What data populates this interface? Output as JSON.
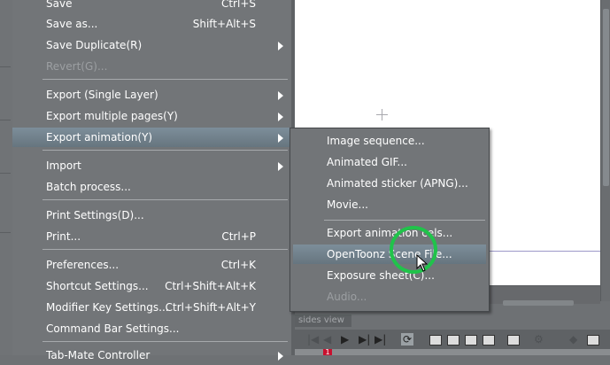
{
  "main_menu": {
    "items": [
      {
        "label": "Save",
        "shortcut": "Ctrl+S"
      },
      {
        "label": "Save as...",
        "shortcut": "Shift+Alt+S"
      },
      {
        "label": "Save Duplicate(R)"
      },
      {
        "label": "Revert(G)..."
      },
      {
        "label": "Export (Single Layer)"
      },
      {
        "label": "Export multiple pages(Y)"
      },
      {
        "label": "Export animation(Y)"
      },
      {
        "label": "Import"
      },
      {
        "label": "Batch process..."
      },
      {
        "label": "Print Settings(D)..."
      },
      {
        "label": "Print...",
        "shortcut": "Ctrl+P"
      },
      {
        "label": "Preferences...",
        "shortcut": "Ctrl+K"
      },
      {
        "label": "Shortcut Settings...",
        "shortcut": "Ctrl+Shift+Alt+K"
      },
      {
        "label": "Modifier Key Settings...",
        "shortcut": "Ctrl+Shift+Alt+Y"
      },
      {
        "label": "Command Bar Settings..."
      },
      {
        "label": "Tab-Mate Controller"
      }
    ]
  },
  "export_animation_submenu": {
    "items": [
      {
        "label": "Image sequence..."
      },
      {
        "label": "Animated GIF..."
      },
      {
        "label": "Animated sticker (APNG)..."
      },
      {
        "label": "Movie..."
      },
      {
        "label": "Export animation cels..."
      },
      {
        "label": "OpenToonz Scene File..."
      },
      {
        "label": "Exposure sheet(C)..."
      },
      {
        "label": "Audio..."
      }
    ]
  },
  "timeline": {
    "panel_label": "sides view",
    "current_frame": "1"
  },
  "icons": {
    "submenu_arrow": "chevron-right-icon",
    "first_frame": "first-frame-icon",
    "prev_frame": "prev-frame-icon",
    "play": "play-icon",
    "next_frame": "next-frame-icon",
    "last_frame": "last-frame-icon",
    "loop": "loop-icon",
    "cursor": "mouse-pointer-icon"
  },
  "colors": {
    "menu_bg": "#727578",
    "highlight": "#6f808b",
    "cursor_ring": "#20c34a",
    "frame_marker": "#c8102e"
  }
}
